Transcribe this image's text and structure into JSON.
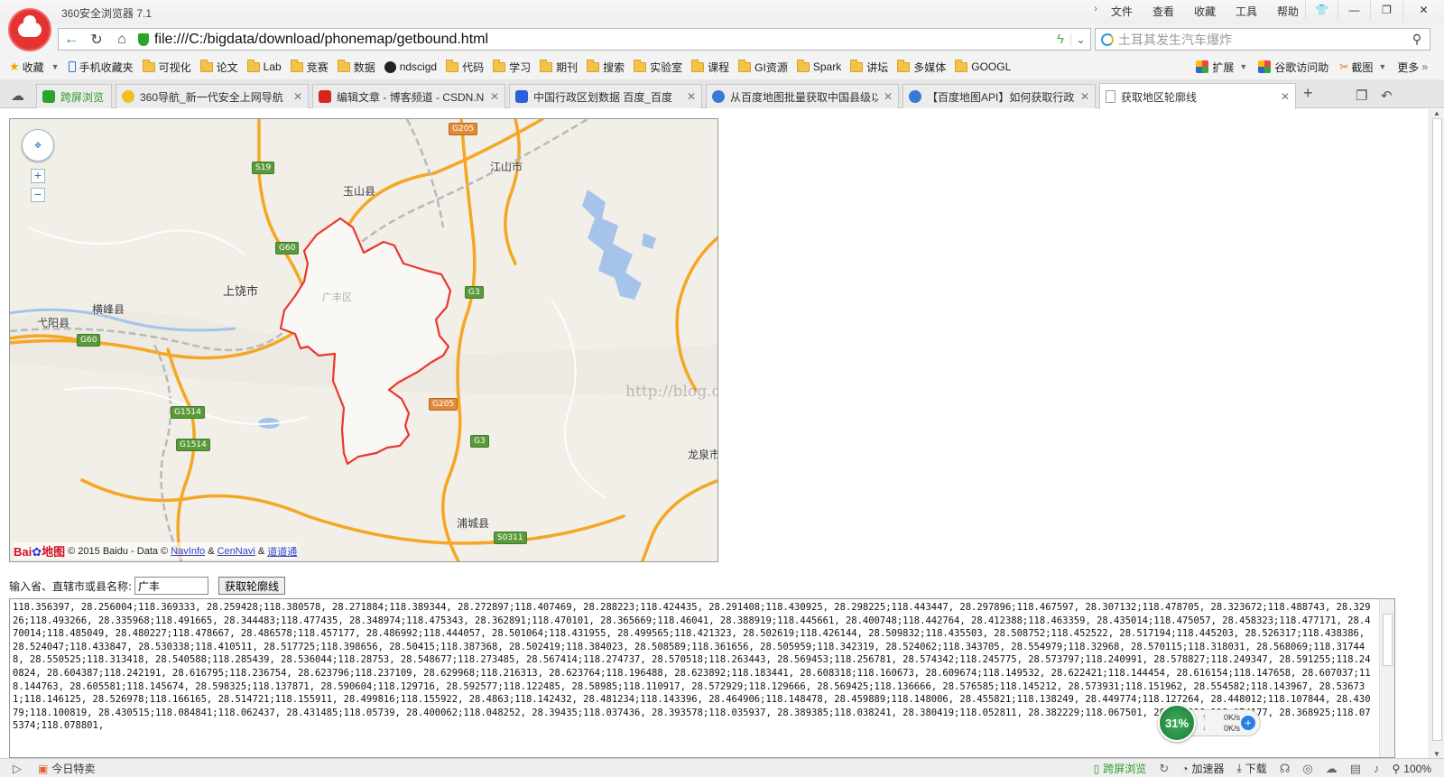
{
  "app": {
    "title": "360安全浏览器 7.1"
  },
  "menu": {
    "file": "文件",
    "view": "查看",
    "favorites": "收藏",
    "tools": "工具",
    "help": "帮助"
  },
  "window_controls": {
    "skin": "👕",
    "minimize": "—",
    "restore": "❐",
    "close": "✕"
  },
  "address": {
    "url": "file:///C:/bigdata/download/phonemap/getbound.html"
  },
  "search": {
    "placeholder": "土耳其发生汽车爆炸"
  },
  "bookmarks": {
    "items": [
      "收藏",
      "手机收藏夹",
      "可视化",
      "论文",
      "Lab",
      "竞赛",
      "数据",
      "ndscigd",
      "代码",
      "学习",
      "期刊",
      "搜索",
      "实验室",
      "课程",
      "GI资源",
      "Spark",
      "讲坛",
      "多媒体",
      "GOOGL"
    ],
    "right": {
      "extensions": "扩展",
      "google_access": "谷歌访问助",
      "screenshot": "截图",
      "more": "更多"
    }
  },
  "tabs": [
    {
      "label": "跨屏浏览",
      "icon_color": "#2aa52a"
    },
    {
      "label": "360导航_新一代安全上网导航",
      "icon_color": "#f0c020"
    },
    {
      "label": "编辑文章 - 博客频道 - CSDN.N",
      "icon_color": "#d9261c"
    },
    {
      "label": "中国行政区划数据  百度_百度",
      "icon_color": "#2b5fd9"
    },
    {
      "label": "从百度地图批量获取中国县级以",
      "icon_color": "#3a78d8"
    },
    {
      "label": "【百度地图API】如何获取行政",
      "icon_color": "#3a78d8"
    },
    {
      "label": "获取地区轮廓线",
      "icon_color": "#ffffff"
    }
  ],
  "map": {
    "labels": {
      "guangfeng": "广丰区",
      "shangrao": "上饶市",
      "yushan": "玉山县",
      "jiangshan": "江山市",
      "hengfeng": "横峰县",
      "yiyang": "弋阳县",
      "pucheng": "浦城县",
      "longquan": "龙泉市"
    },
    "road_shields": {
      "g205": "G205",
      "s19": "S19",
      "g60": "G60",
      "g3": "G3",
      "g1514": "G1514",
      "s0311": "S0311"
    },
    "zoom_in": "+",
    "zoom_out": "−",
    "watermark": "http://blog.csdn.net/",
    "copyright": {
      "logo_left": "Bai",
      "logo_right": "地图",
      "text": "© 2015 Baidu - Data ©",
      "navinfo": "NavInfo",
      "amp1": "&",
      "cennavi": "CenNavi",
      "amp2": "&",
      "daodaotong": "道道通"
    },
    "colors": {
      "boundary": "#e8382e",
      "highway": "#f5a623",
      "water": "#a6c4ea"
    }
  },
  "form": {
    "label": "输入省、直辖市或县名称:",
    "input_value": "广丰",
    "button": "获取轮廓线"
  },
  "result_text": "118.356397, 28.256004;118.369333, 28.259428;118.380578, 28.271884;118.389344, 28.272897;118.407469, 28.288223;118.424435, 28.291408;118.430925, 28.298225;118.443447, 28.297896;118.467597, 28.307132;118.478705, 28.323672;118.488743, 28.32926;118.493266, 28.335968;118.491665, 28.344483;118.477435, 28.348974;118.475343, 28.362891;118.470101, 28.365669;118.46041, 28.388919;118.445661, 28.400748;118.442764, 28.412388;118.463359, 28.435014;118.475057, 28.458323;118.477171, 28.470014;118.485049, 28.480227;118.478667, 28.486578;118.457177, 28.486992;118.444057, 28.501064;118.431955, 28.499565;118.421323, 28.502619;118.426144, 28.509832;118.435503, 28.508752;118.452522, 28.517194;118.445203, 28.526317;118.438386, 28.524047;118.433847, 28.530338;118.410511, 28.517725;118.398656, 28.50415;118.387368, 28.502419;118.384023, 28.508589;118.361656, 28.505959;118.342319, 28.524062;118.343705, 28.554979;118.32968, 28.570115;118.318031, 28.568069;118.317448, 28.550525;118.313418, 28.540588;118.285439, 28.536044;118.28753, 28.548677;118.273485, 28.567414;118.274737, 28.570518;118.263443, 28.569453;118.256781, 28.574342;118.245775, 28.573797;118.240991, 28.578827;118.249347, 28.591255;118.240824, 28.604387;118.242191, 28.616795;118.236754, 28.623796;118.237109, 28.629968;118.216313, 28.623764;118.196488, 28.623892;118.183441, 28.608318;118.160673, 28.609674;118.149532, 28.622421;118.144454, 28.616154;118.147658, 28.607037;118.144763, 28.605581;118.145674, 28.598325;118.137871, 28.590604;118.129716, 28.592577;118.122485, 28.58985;118.110917, 28.572929;118.129666, 28.569425;118.136666, 28.576585;118.145212, 28.573931;118.151962, 28.554582;118.143967, 28.536731;118.146125, 28.526978;118.166165, 28.514721;118.155911, 28.499816;118.155922, 28.4863;118.142432, 28.481234;118.143396, 28.464906;118.148478, 28.459889;118.148006, 28.455821;118.138249, 28.449774;118.127264, 28.448012;118.107844, 28.43079;118.100819, 28.430515;118.084841;118.062437, 28.431485;118.05739, 28.400062;118.048252, 28.39435;118.037436, 28.393578;118.035937, 28.389385;118.038241, 28.380419;118.052811, 28.382229;118.067501, 28.366096;118.074177, 28.368925;118.075374;118.078801,",
  "speed": {
    "percent": "31%",
    "up": "0K/s",
    "down": "0K/s"
  },
  "status": {
    "today": "今日特卖",
    "cross_screen": "跨屏浏览",
    "accelerator": "加速器",
    "download": "下载",
    "zoom": "100%"
  }
}
